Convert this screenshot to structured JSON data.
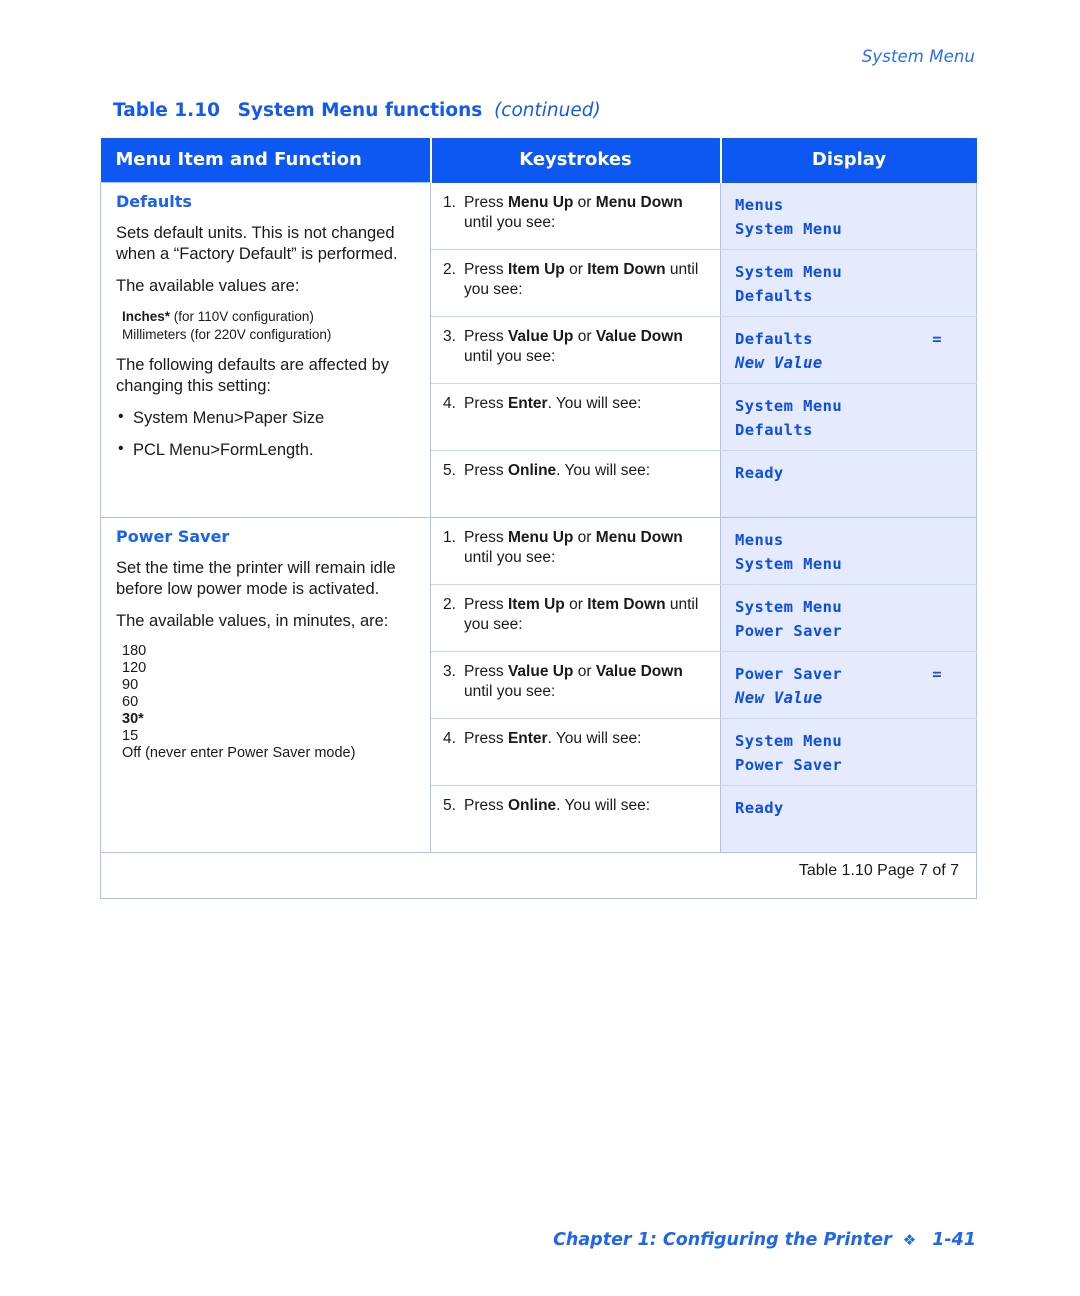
{
  "running_head": "System Menu",
  "table_caption": {
    "label": "Table 1.10",
    "title": "System Menu functions",
    "continued": "(continued)"
  },
  "table": {
    "headers": {
      "col1": "Menu Item and Function",
      "col2": "Keystrokes",
      "col3": "Display"
    },
    "sections": [
      {
        "name": "Defaults",
        "description_paragraphs": [
          "Sets default units. This is not changed when a “Factory Default” is performed.",
          "The available values are:"
        ],
        "values_note_line1_bold": "Inches*",
        "values_note_line1_rest": " (for 110V configuration)",
        "values_note_line2": "Millimeters (for 220V configuration)",
        "affected_intro": "The following defaults are affected by changing this setting:",
        "bullets": [
          "System Menu>Paper Size",
          "PCL Menu>FormLength."
        ],
        "steps": [
          {
            "num": "1.",
            "text_html": "Press <b>Menu Up</b> or <b>Menu Down</b> until you see:",
            "display_line1": "Menus",
            "display_line2": "System Menu",
            "display_equals": "",
            "display_line2_italic": false
          },
          {
            "num": "2.",
            "text_html": "Press <b>Item Up</b> or <b>Item Down</b> until you see:",
            "display_line1": "System Menu",
            "display_line2": "Defaults",
            "display_equals": "",
            "display_line2_italic": false
          },
          {
            "num": "3.",
            "text_html": "Press <b>Value Up</b> or <b>Value Down</b> until you see:",
            "display_line1": "Defaults",
            "display_line2": "New Value",
            "display_equals": "=",
            "display_line2_italic": true
          },
          {
            "num": "4.",
            "text_html": "Press <b>Enter</b>. You will see:",
            "display_line1": "System Menu",
            "display_line2": "Defaults",
            "display_equals": "",
            "display_line2_italic": false
          },
          {
            "num": "5.",
            "text_html": "Press <b>Online</b>. You will see:",
            "display_line1": "Ready",
            "display_line2": "",
            "display_equals": "",
            "display_line2_italic": false
          }
        ]
      },
      {
        "name": "Power Saver",
        "description_paragraphs": [
          "Set the time the printer will remain idle before low power mode is activated.",
          "The available values, in minutes, are:"
        ],
        "value_list": [
          "180",
          "120",
          "90",
          "60",
          "30*",
          "15",
          "Off (never enter Power Saver mode)"
        ],
        "value_list_bold_index": 4,
        "steps": [
          {
            "num": "1.",
            "text_html": "Press <b>Menu Up</b> or <b>Menu Down</b> until you see:",
            "display_line1": "Menus",
            "display_line2": "System Menu",
            "display_equals": "",
            "display_line2_italic": false
          },
          {
            "num": "2.",
            "text_html": "Press <b>Item Up</b> or <b>Item Down</b> until you see:",
            "display_line1": "System Menu",
            "display_line2": "Power Saver",
            "display_equals": "",
            "display_line2_italic": false
          },
          {
            "num": "3.",
            "text_html": "Press <b>Value Up</b> or <b>Value Down</b> until you see:",
            "display_line1": "Power Saver",
            "display_line2": "New Value",
            "display_equals": "=",
            "display_line2_italic": true
          },
          {
            "num": "4.",
            "text_html": "Press <b>Enter</b>. You will see:",
            "display_line1": "System Menu",
            "display_line2": "Power Saver",
            "display_equals": "",
            "display_line2_italic": false
          },
          {
            "num": "5.",
            "text_html": "Press <b>Online</b>. You will see:",
            "display_line1": "Ready",
            "display_line2": "",
            "display_equals": "",
            "display_line2_italic": false
          }
        ]
      }
    ],
    "table_footer": "Table 1.10  Page 7 of 7"
  },
  "page_footer": {
    "chapter": "Chapter 1: Configuring the Printer",
    "diamond": "❖",
    "page_number": "1-41"
  },
  "colors": {
    "header_blue": "#0d57f2",
    "accent_blue": "#1a62f0",
    "lcd_blue": "#0d4fe0",
    "display_bg": "#e5eafc",
    "border_blue": "#a9c3f2"
  }
}
